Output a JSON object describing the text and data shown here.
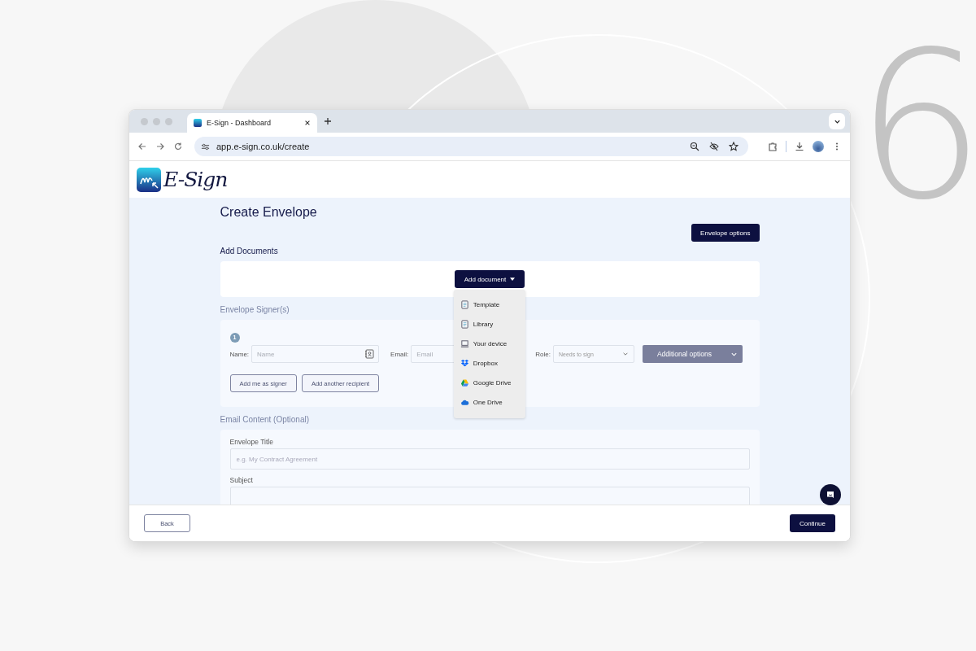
{
  "background": {
    "big_number": "6"
  },
  "browser": {
    "tab_title": "E-Sign - Dashboard",
    "url": "app.e-sign.co.uk/create"
  },
  "brand": {
    "name": "E-Sign"
  },
  "page": {
    "title": "Create Envelope",
    "options_button": "Envelope options"
  },
  "documents": {
    "heading": "Add Documents",
    "add_button": "Add document",
    "menu": [
      {
        "label": "Template",
        "kind": "template"
      },
      {
        "label": "Library",
        "kind": "library"
      },
      {
        "label": "Your device",
        "kind": "device"
      },
      {
        "label": "Dropbox",
        "kind": "dropbox"
      },
      {
        "label": "Google Drive",
        "kind": "gdrive"
      },
      {
        "label": "One Drive",
        "kind": "onedrive"
      }
    ]
  },
  "signers": {
    "heading": "Envelope Signer(s)",
    "items": [
      {
        "number": "1",
        "name_label": "Name:",
        "name_placeholder": "Name",
        "email_label": "Email:",
        "email_placeholder": "Email",
        "role_label": "Role:",
        "role_value": "Needs to sign",
        "options_button": "Additional options"
      }
    ],
    "add_me": "Add me as signer",
    "add_another": "Add another recipient"
  },
  "email_content": {
    "heading": "Email Content (Optional)",
    "fields": [
      {
        "label": "Envelope Title",
        "placeholder": "e.g. My Contract Agreement"
      },
      {
        "label": "Subject"
      }
    ]
  },
  "footer": {
    "back": "Back",
    "continue": "Continue"
  }
}
